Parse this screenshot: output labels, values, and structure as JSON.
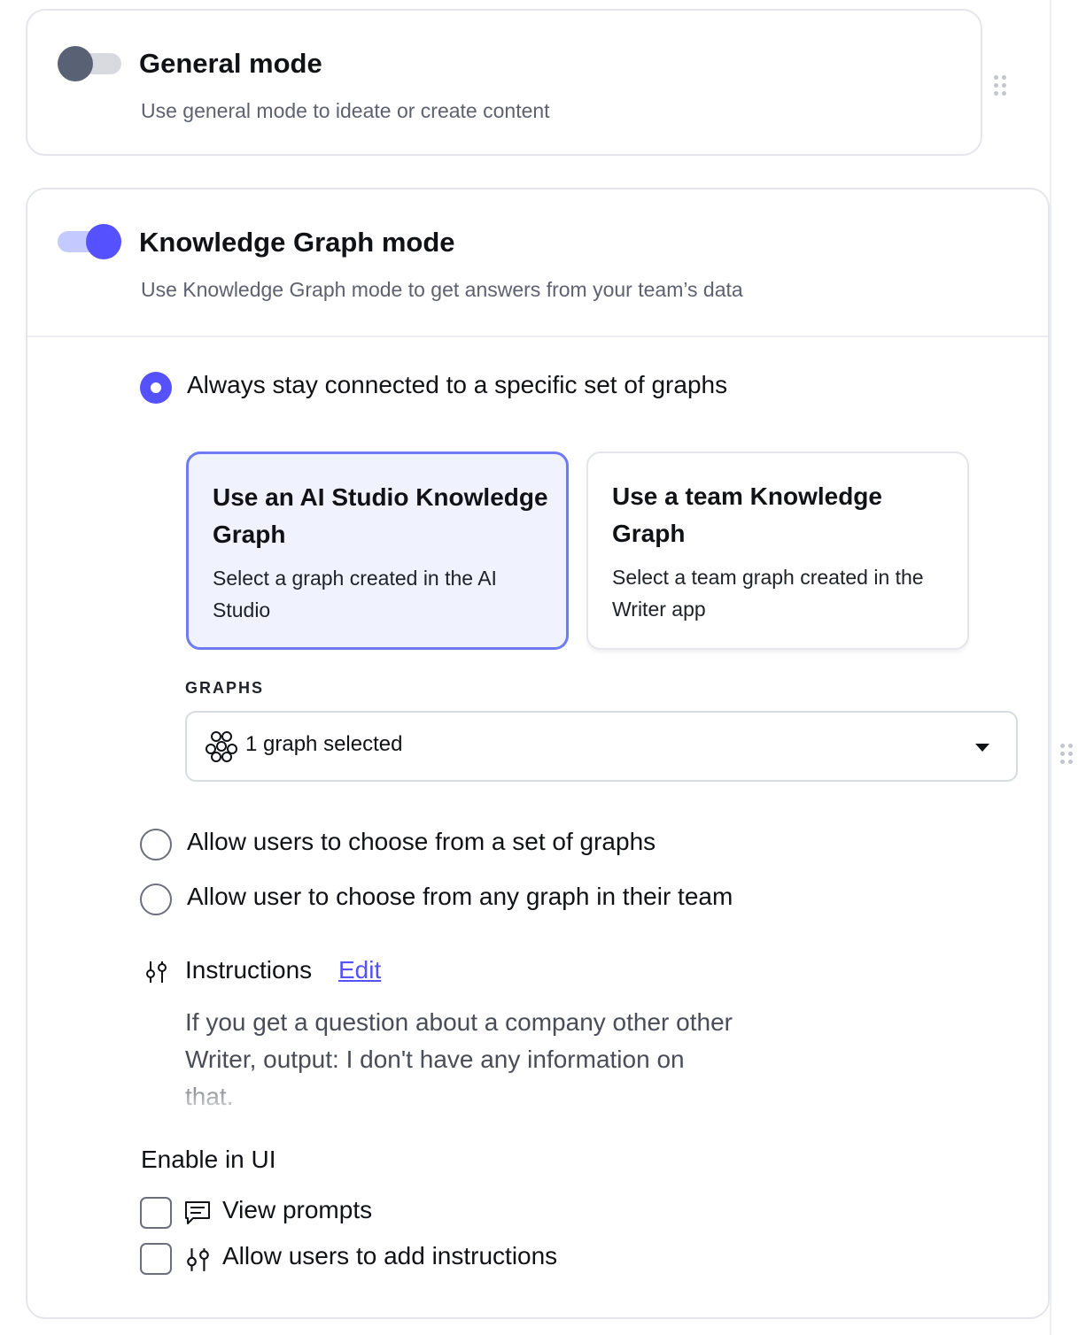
{
  "general_mode": {
    "title": "General mode",
    "description": "Use general mode to ideate or create content",
    "enabled": false
  },
  "knowledge_graph_mode": {
    "title": "Knowledge Graph mode",
    "description": "Use Knowledge Graph mode to get answers from your team’s data",
    "enabled": true,
    "radio_options": [
      {
        "label": "Always stay connected to a specific set of graphs",
        "selected": true
      },
      {
        "label": "Allow users to choose from a set of graphs",
        "selected": false
      },
      {
        "label": "Allow user to choose from any graph in their team",
        "selected": false
      }
    ],
    "source_options": [
      {
        "title": "Use an AI Studio Knowledge Graph",
        "description": "Select a graph created in the AI Studio",
        "selected": true
      },
      {
        "title": "Use a team Knowledge Graph",
        "description": "Select a team graph created in the Writer app",
        "selected": false
      }
    ],
    "graphs": {
      "label": "GRAPHS",
      "value": "1 graph selected",
      "icon": "graph-nodes-icon"
    },
    "instructions": {
      "label": "Instructions",
      "edit_label": "Edit",
      "text": "If you get a question about a company other other Writer, output: I don't have any information on that."
    },
    "enable_in_ui": {
      "label": "Enable in UI",
      "items": [
        {
          "label": "View prompts",
          "icon": "prompts-icon",
          "checked": false
        },
        {
          "label": "Allow users to add instructions",
          "icon": "sliders-icon",
          "checked": false
        }
      ]
    }
  },
  "colors": {
    "accent": "#5551ff",
    "toggle_off_knob": "#596275",
    "selected_card_bg": "#f0f2fd",
    "selected_card_border": "#6f7bf2"
  }
}
